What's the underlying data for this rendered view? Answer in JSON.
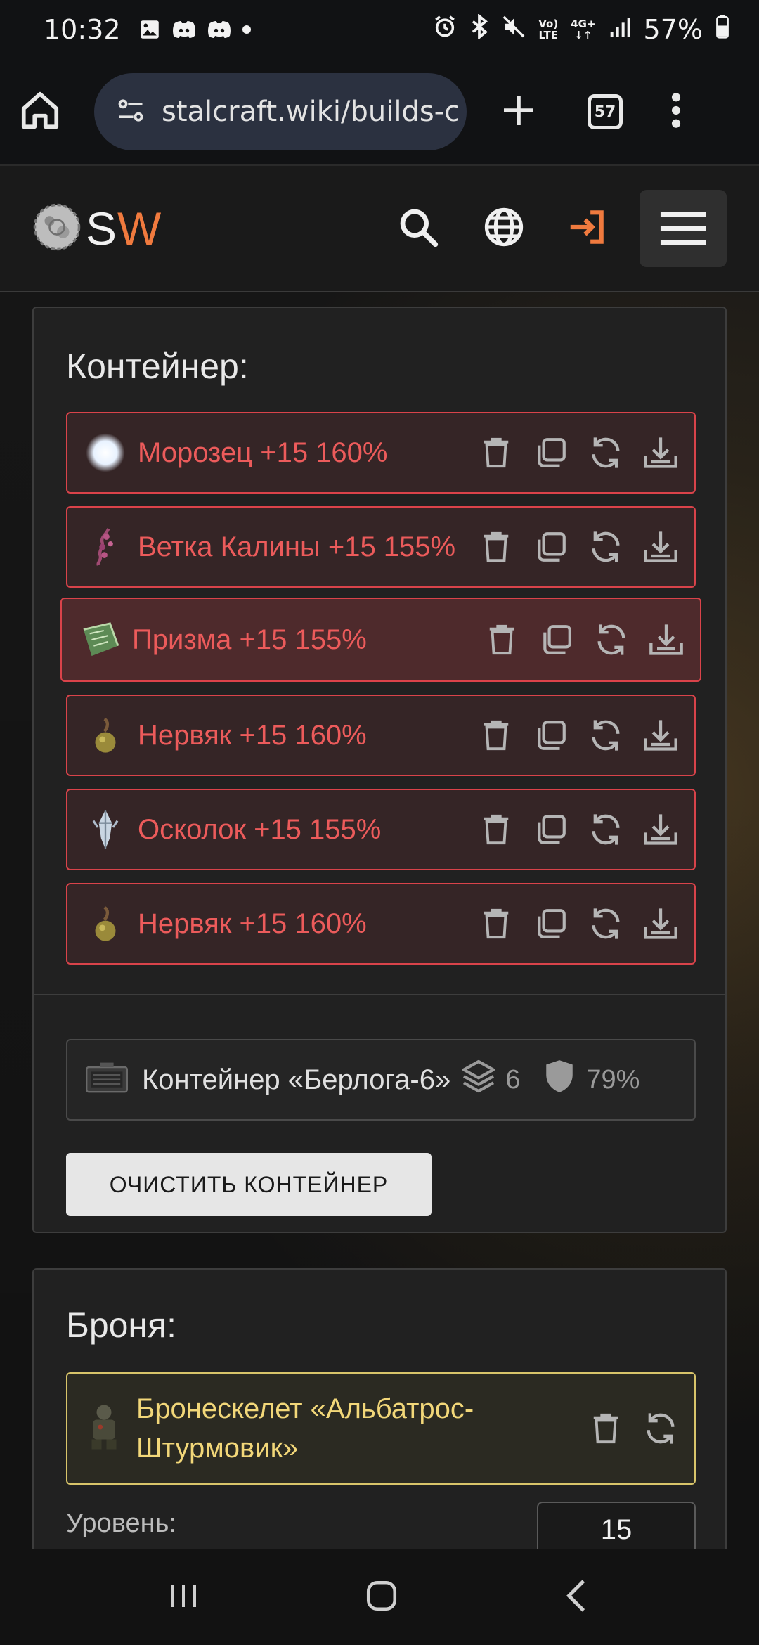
{
  "status_bar": {
    "time": "10:32",
    "net_top": "Vo)",
    "net_bottom": "LTE",
    "net2_top": "4G+",
    "battery": "57%"
  },
  "browser": {
    "url": "stalcraft.wiki/builds-c",
    "tab_count": "57"
  },
  "site": {
    "logo_s": "S",
    "logo_w": "W",
    "accent": "#f07a3e"
  },
  "container_panel": {
    "title": "Контейнер:",
    "items": [
      {
        "name": "Морозец +15 160%"
      },
      {
        "name": "Ветка Калины +15 155%"
      },
      {
        "name": "Призма +15 155%"
      },
      {
        "name": "Нервяк +15 160%"
      },
      {
        "name": "Осколок +15 155%"
      },
      {
        "name": "Нервяк +15 160%"
      }
    ],
    "container": {
      "name": "Контейнер «Берлога-6»",
      "capacity": "6",
      "protection": "79%"
    },
    "clear_button": "ОЧИСТИТЬ КОНТЕЙНЕР"
  },
  "armor_panel": {
    "title": "Броня:",
    "armor_line1": "Бронескелет «Альбатрос-",
    "armor_line2": "Штурмовик»",
    "level_label": "Уровень:",
    "level_value": "15"
  },
  "colors": {
    "artifact_border": "#d9434a",
    "artifact_text": "#ec5b5b",
    "armor_border": "#d8c46a",
    "armor_text": "#f2d779"
  }
}
